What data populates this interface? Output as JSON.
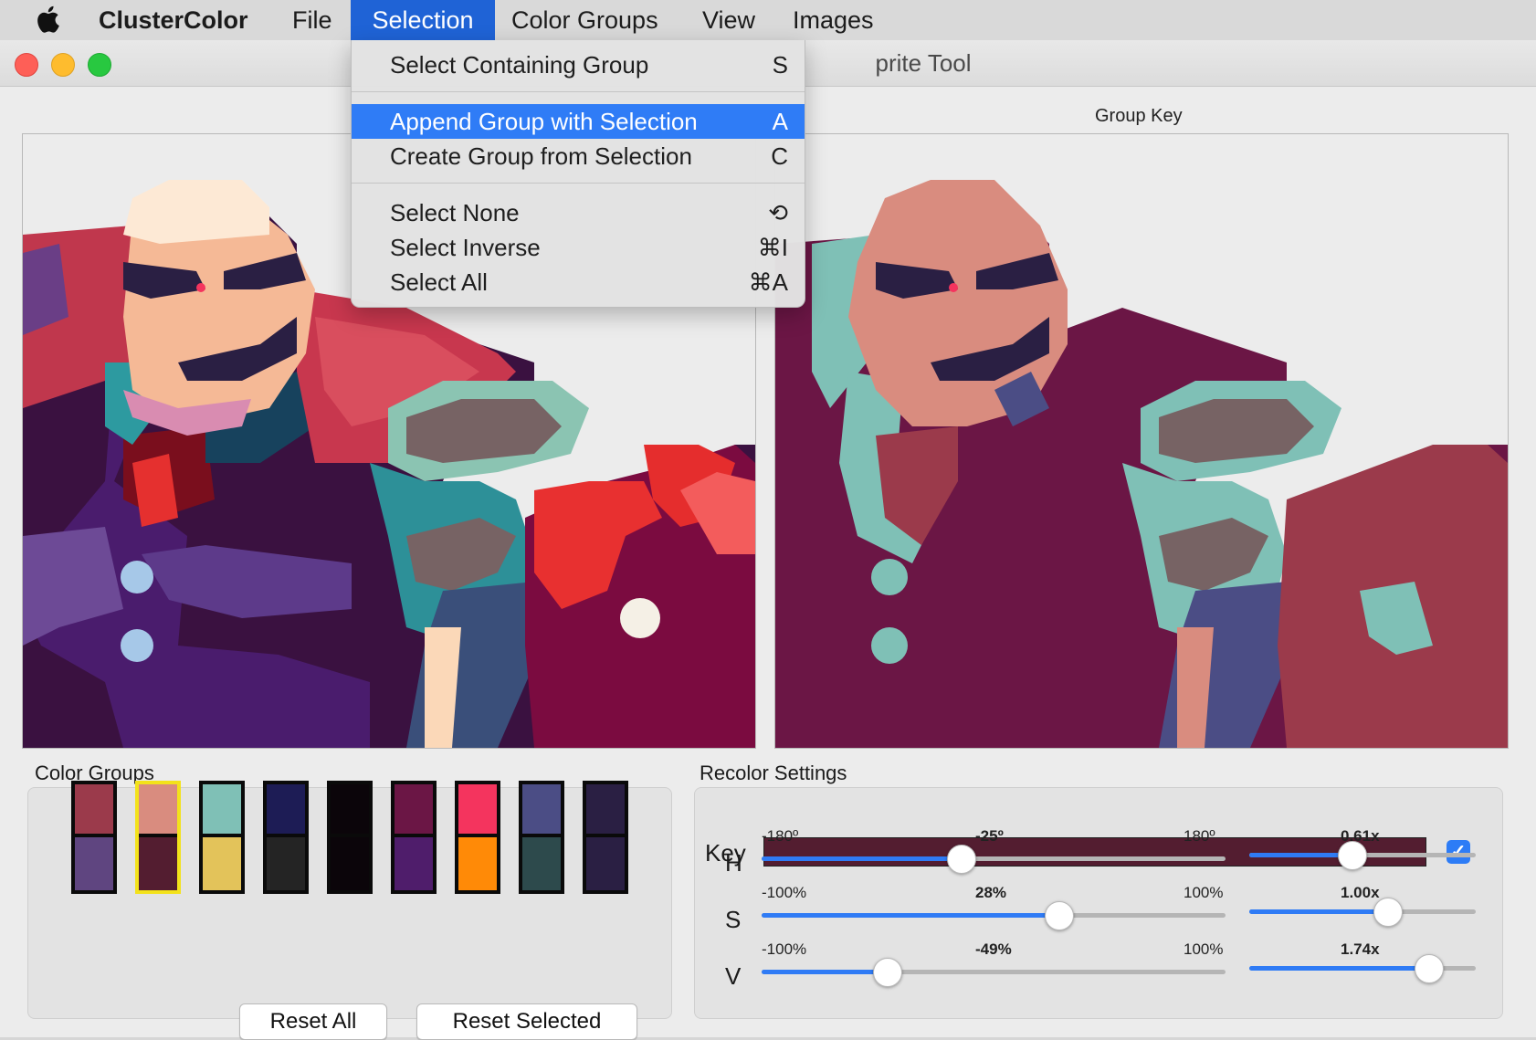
{
  "menubar": {
    "app_name": "ClusterColor",
    "items": [
      "File",
      "Selection",
      "Color Groups",
      "View",
      "Images"
    ]
  },
  "window": {
    "title": "prite Tool"
  },
  "dropdown": {
    "items": [
      {
        "label": "Select Containing Group",
        "shortcut": "S"
      },
      {
        "label": "Append Group with Selection",
        "shortcut": "A",
        "highlighted": true
      },
      {
        "label": "Create Group from Selection",
        "shortcut": "C"
      },
      {
        "label": "Select None",
        "shortcut": "⟲"
      },
      {
        "label": "Select Inverse",
        "shortcut": "⌘I"
      },
      {
        "label": "Select All",
        "shortcut": "⌘A"
      }
    ]
  },
  "panels": {
    "right_label": "Group Key"
  },
  "color_groups": {
    "title": "Color Groups",
    "swatches": [
      {
        "top": "#9b3a4b",
        "bottom": "#5f4580",
        "selected": false
      },
      {
        "top": "#d98c7f",
        "bottom": "#531d30",
        "selected": true
      },
      {
        "top": "#7fc0b6",
        "bottom": "#e3c35a",
        "selected": false
      },
      {
        "top": "#1d1c55",
        "bottom": "#242424",
        "selected": false
      },
      {
        "top": "#0b050a",
        "bottom": "#0b050a",
        "selected": false
      },
      {
        "top": "#6b1645",
        "bottom": "#4f1d6b",
        "selected": false
      },
      {
        "top": "#f4345e",
        "bottom": "#ff8a07",
        "selected": false
      },
      {
        "top": "#4b4d85",
        "bottom": "#2d4a4c",
        "selected": false
      },
      {
        "top": "#2a1f43",
        "bottom": "#2a1f43",
        "selected": false
      }
    ],
    "reset_all": "Reset All",
    "reset_selected": "Reset Selected"
  },
  "recolor": {
    "title": "Recolor Settings",
    "key_label": "Key",
    "key_color": "#531d30",
    "key_checked": "✓",
    "rows": [
      {
        "letter": "H",
        "min": "-180º",
        "value": "-25º",
        "max": "180º",
        "mult": "0.61x",
        "fraction": 0.43,
        "mult_fraction": 0.45
      },
      {
        "letter": "S",
        "min": "-100%",
        "value": "28%",
        "max": "100%",
        "mult": "1.00x",
        "fraction": 0.64,
        "mult_fraction": 0.61
      },
      {
        "letter": "V",
        "min": "-100%",
        "value": "-49%",
        "max": "100%",
        "mult": "1.74x",
        "fraction": 0.27,
        "mult_fraction": 0.79
      }
    ]
  },
  "colors": {
    "menu_highlight": "#2f7cf6",
    "selection_menu": "#1f63d6",
    "slider_fill": "#2f7bf5"
  }
}
